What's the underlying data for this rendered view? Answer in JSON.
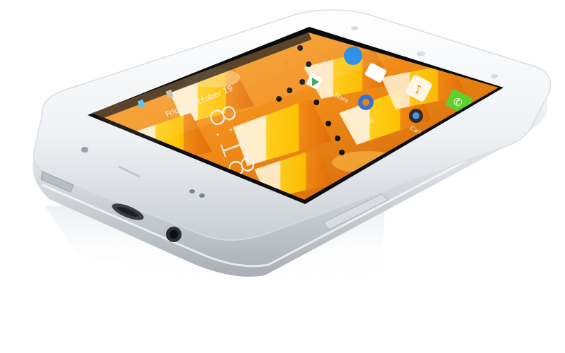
{
  "photo": {
    "subject": "white touchscreen smartphone lying on a reflective white surface",
    "screen": {
      "clock_text": "8:18",
      "date_text": "Friday, October 19",
      "app_labels": [
        "Play Store",
        "Settings",
        "Camera"
      ],
      "wallpaper": "candy corn"
    },
    "colors": {
      "body": "#f4f6f8",
      "bezel": "#ffffff",
      "frame": "#d4d8dc",
      "screen_black": "#0b0b0b",
      "candy_orange": "#f08a16",
      "candy_yellow": "#ffd21f",
      "candy_white": "#fff3d6",
      "phone_icon_green": "#5fcf2e"
    }
  }
}
